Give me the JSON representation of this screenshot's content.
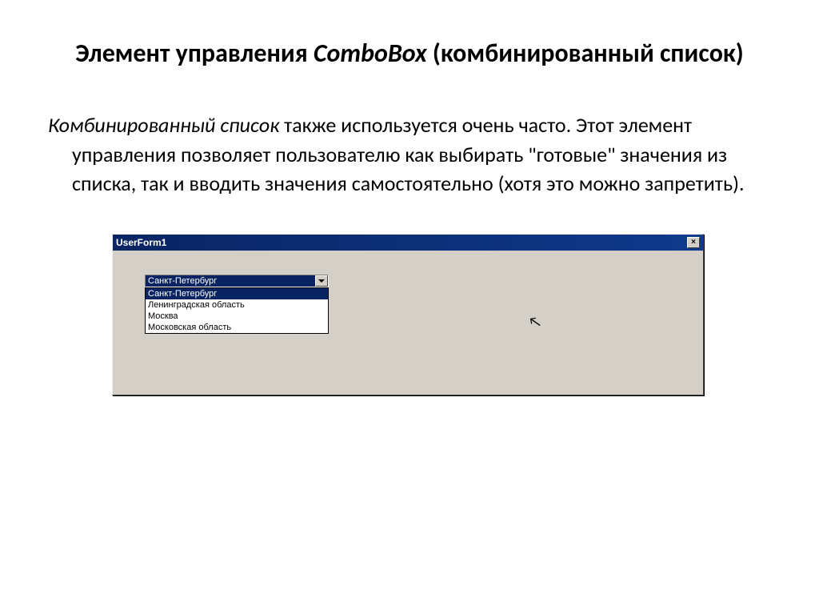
{
  "title": {
    "part1": "Элемент управления ",
    "italic": "ComboBox",
    "part2": " (комбинированный список)"
  },
  "paragraph": {
    "italic": "Комбинированный список",
    "rest": " также используется очень часто. Этот элемент управления позволяет пользователю как выбирать \"готовые\" значения из списка, так и вводить значения самостоятельно (хотя это можно запретить)."
  },
  "userform": {
    "title": "UserForm1",
    "close": "×",
    "combobox": {
      "value": "Санкт-Петербург"
    },
    "dropdown": {
      "items": [
        "Санкт-Петербург",
        "Ленинградская область",
        "Москва",
        "Московская область"
      ],
      "selectedIndex": 0
    }
  }
}
